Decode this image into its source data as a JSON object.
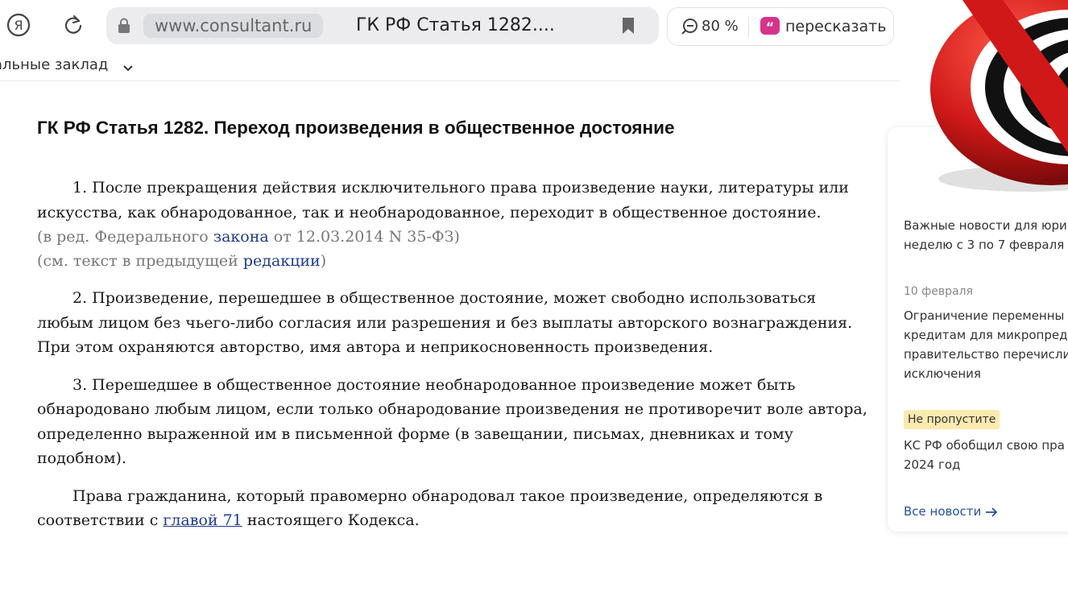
{
  "browser": {
    "ya_glyph": "Я",
    "url": "www.consultant.ru",
    "tab_title": "ГК РФ Статья 1282....",
    "zoom": "80 %",
    "retell_label": "пересказать",
    "bookmarks_label": "альные заклад",
    "icons": [
      "yandex-icon",
      "reload-icon",
      "lock-icon",
      "bookmark-icon",
      "zoom-icon",
      "retell-icon",
      "chevron-down-icon"
    ]
  },
  "article": {
    "title": "ГК РФ Статья 1282. Переход произведения в общественное достояние",
    "p1": "1. После прекращения действия исключительного права произведение науки, литературы или искусства, как обнародованное, так и необнародованное, переходит в общественное достояние.",
    "note1": {
      "pre": "(в ред. Федерального ",
      "link": "закона",
      "post": " от 12.03.2014 N 35-ФЗ)"
    },
    "note2": {
      "pre": "(см. текст в предыдущей ",
      "link": "редакции",
      "post": ")"
    },
    "p2": "2. Произведение, перешедшее в общественное достояние, может свободно использоваться любым лицом без чьего-либо согласия или разрешения и без выплаты авторского вознаграждения. При этом охраняются авторство, имя автора и неприкосновенность произведения.",
    "p3": "3. Перешедшее в общественное достояние необнародованное произведение может быть обнародовано любым лицом, если только обнародование произведения не противоречит воле автора, определенно выраженной им в письменной форме (в завещании, письмах, дневниках и тому подобном).",
    "p4": {
      "pre": "Права гражданина, который правомерно обнародовал такое произведение, определяются в соответствии с ",
      "link": "главой 71",
      "post": " настоящего Кодекса."
    }
  },
  "sidebar": {
    "news1": [
      "Важные новости для юри",
      "неделю с 3 по 7 февраля"
    ],
    "date": "10 февраля",
    "news2": [
      "Ограничение переменны",
      "кредитам для микропред",
      "правительство перечисли",
      "исключения"
    ],
    "badge": "Не пропустите",
    "news3": [
      "КС РФ обобщил свою пра",
      "2024 год"
    ],
    "all_news": "Все новости"
  },
  "colors": {
    "link": "#1f3a8f",
    "note": "#777777",
    "badge_bg": "#fbeab0",
    "logo_red": "#d01818"
  }
}
